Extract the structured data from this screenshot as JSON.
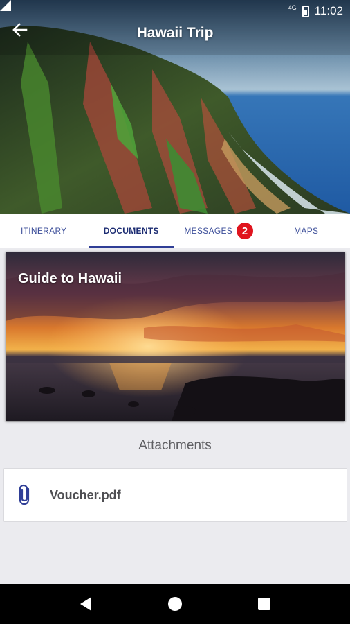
{
  "status": {
    "network": "4G",
    "time": "11:02"
  },
  "appbar": {
    "title": "Hawaii Trip",
    "back_icon": "arrow-back-icon"
  },
  "tabs": [
    {
      "label": "ITINERARY",
      "active": false
    },
    {
      "label": "DOCUMENTS",
      "active": true
    },
    {
      "label": "MESSAGES",
      "active": false,
      "badge": "2"
    },
    {
      "label": "MAPS",
      "active": false
    }
  ],
  "guide": {
    "title": "Guide to Hawaii"
  },
  "attachments": {
    "heading": "Attachments",
    "items": [
      {
        "name": "Voucher.pdf",
        "icon": "paperclip-icon"
      }
    ]
  },
  "colors": {
    "accent": "#2f3e96",
    "badge": "#e0141e",
    "background": "#ebebef"
  }
}
